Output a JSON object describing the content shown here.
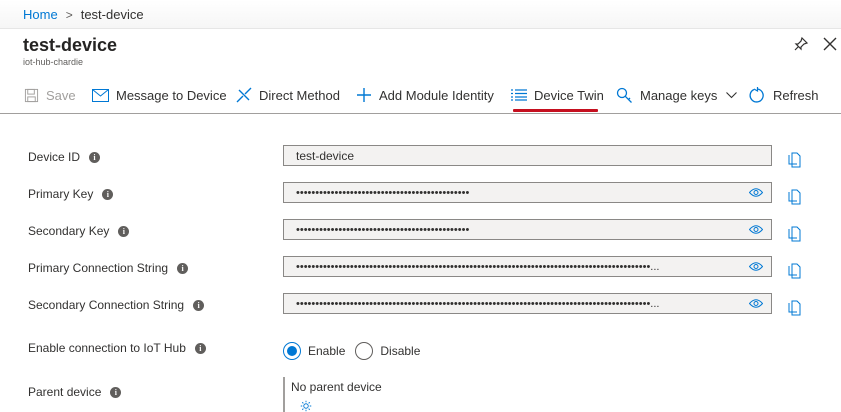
{
  "breadcrumb": {
    "home": "Home",
    "separator": ">",
    "current": "test-device"
  },
  "header": {
    "title": "test-device",
    "subtitle": "iot-hub-chardie"
  },
  "toolbar": {
    "save": "Save",
    "message": "Message to Device",
    "direct_method": "Direct Method",
    "add_module": "Add Module Identity",
    "device_twin": "Device Twin",
    "manage_keys": "Manage keys",
    "refresh": "Refresh"
  },
  "fields": {
    "device_id": {
      "label": "Device ID",
      "value": "test-device"
    },
    "primary_key": {
      "label": "Primary Key",
      "value": "•••••••••••••••••••••••••••••••••••••••••••••"
    },
    "secondary_key": {
      "label": "Secondary Key",
      "value": "•••••••••••••••••••••••••••••••••••••••••••••"
    },
    "primary_conn": {
      "label": "Primary Connection String",
      "value": "••••••••••••••••••••••••••••••••••••••••••••••••••••••••••••••••••••••••••••••••••••••••••••..."
    },
    "secondary_conn": {
      "label": "Secondary Connection String",
      "value": "••••••••••••••••••••••••••••••••••••••••••••••••••••••••••••••••••••••••••••••••••••••••••••..."
    }
  },
  "connection": {
    "label": "Enable connection to IoT Hub",
    "enable": "Enable",
    "disable": "Disable",
    "selected": "Enable"
  },
  "parent": {
    "label": "Parent device",
    "value": "No parent device"
  },
  "colors": {
    "accent": "#0078d4",
    "highlight": "#c50f1f"
  }
}
